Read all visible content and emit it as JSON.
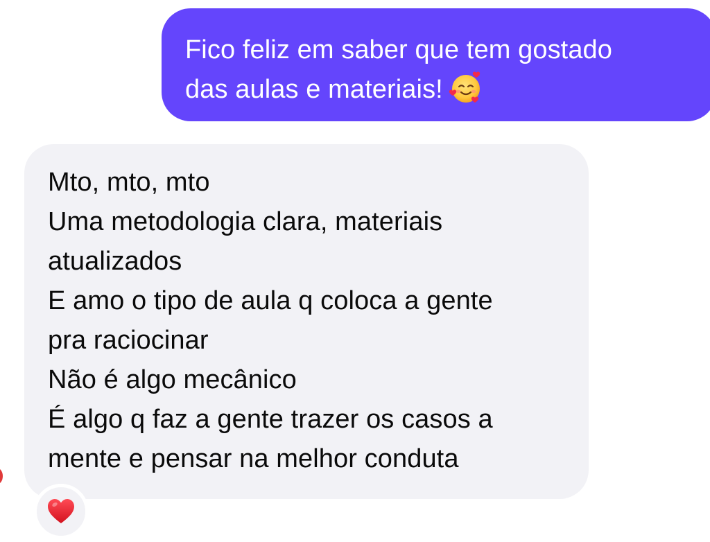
{
  "conversation": {
    "sent_message": {
      "lines": [
        "Fico feliz em saber que tem gostado",
        "das aulas e materiais!"
      ],
      "emoji": "smiling-face-with-hearts-icon"
    },
    "received_message": {
      "lines": [
        "Mto, mto, mto",
        "Uma metodologia clara, materiais",
        "atualizados",
        "E amo o tipo de aula q coloca a gente",
        "pra raciocinar",
        "Não é algo mecânico",
        "É algo q faz a gente trazer os casos a",
        "mente e pensar na melhor conduta"
      ],
      "reaction": "red-heart-icon"
    }
  },
  "colors": {
    "sent_bubble": "#6445fc",
    "received_bubble": "#f2f2f6",
    "sent_text": "#ffffff",
    "received_text": "#0a0a0a",
    "heart": "#e0212e"
  }
}
